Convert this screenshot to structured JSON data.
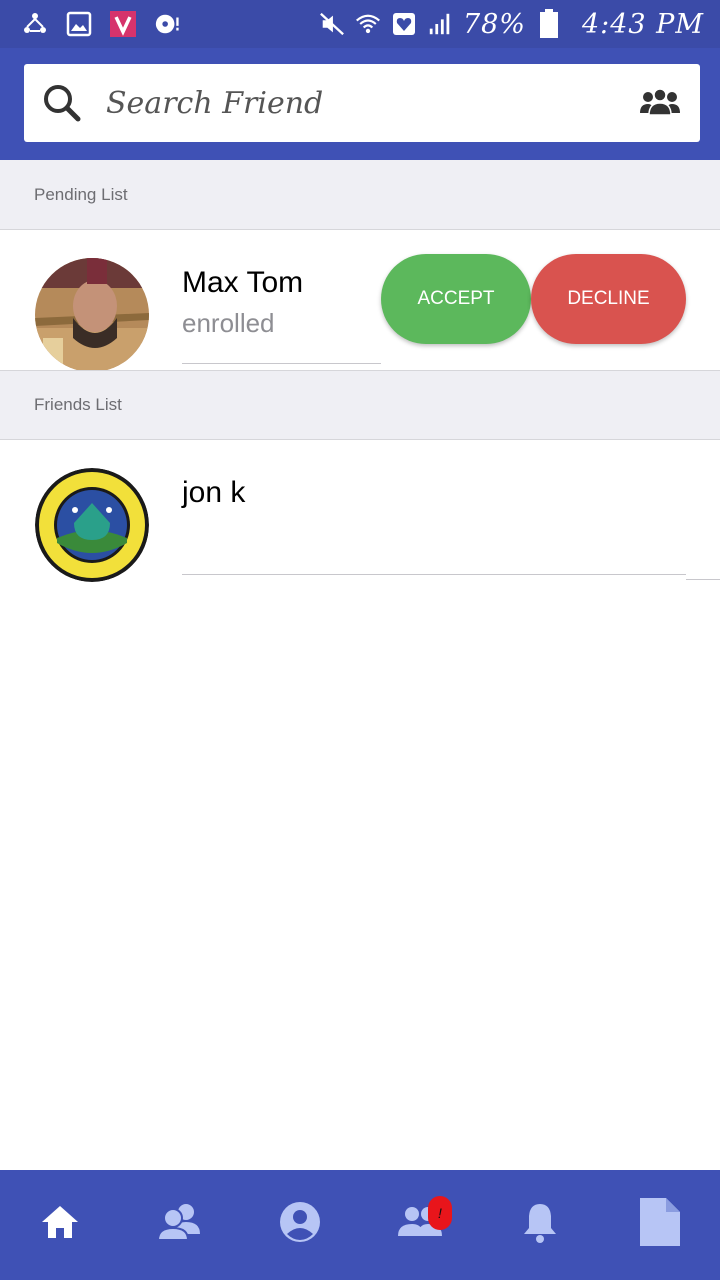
{
  "status_bar": {
    "battery": "78%",
    "time": "4:43 PM"
  },
  "search": {
    "placeholder": "Search Friend"
  },
  "pending": {
    "header": "Pending List",
    "items": [
      {
        "name": "Max Tom",
        "status": "enrolled",
        "accept_label": "ACCEPT",
        "decline_label": "DECLINE"
      }
    ]
  },
  "friends": {
    "header": "Friends List",
    "items": [
      {
        "name": "jon k"
      }
    ]
  },
  "bottom_nav": {
    "items": [
      {
        "icon": "home-icon"
      },
      {
        "icon": "contacts-icon"
      },
      {
        "icon": "profile-icon"
      },
      {
        "icon": "friends-icon"
      },
      {
        "icon": "bell-icon"
      },
      {
        "icon": "document-icon"
      }
    ],
    "friends_badge": "!"
  },
  "colors": {
    "status_bar": "#3b4ba8",
    "primary": "#3f51b5",
    "accept": "#5cb85c",
    "decline": "#d9534f",
    "section_bg": "#efeff4",
    "nav_icon_inactive": "#b7c5f5",
    "badge": "#e8151b"
  }
}
